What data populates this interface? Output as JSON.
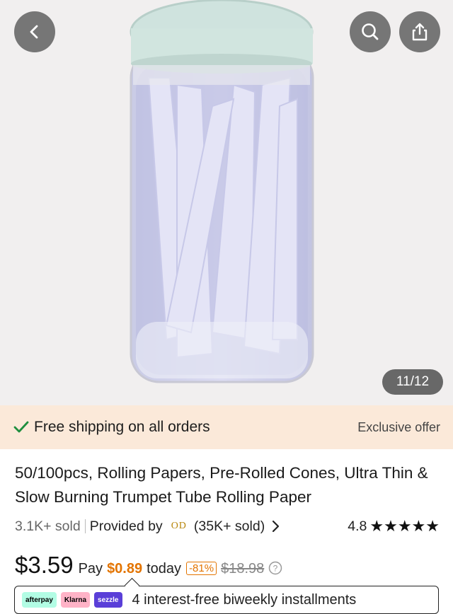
{
  "gallery": {
    "counter": "11/12"
  },
  "shipping": {
    "text": "Free shipping on all orders",
    "offer": "Exclusive offer"
  },
  "product": {
    "title": "50/100pcs, Rolling Papers, Pre-Rolled Cones, Ultra Thin & Slow Burning Trumpet Tube Rolling Paper",
    "sold": "3.1K+ sold",
    "provided_by": "Provided by",
    "provider_logo": "OD",
    "provider_sold": "(35K+ sold)",
    "rating": "4.8",
    "rating_stars": "★★★★★"
  },
  "pricing": {
    "price": "$3.59",
    "pay_label": "Pay",
    "pay_amount": "$0.89",
    "today": "today",
    "discount": "-81%",
    "original_price": "$18.98"
  },
  "installments": {
    "badges": [
      "afterpay",
      "Klarna",
      "sezzle"
    ],
    "text": "4 interest-free biweekly installments"
  },
  "colors": {
    "accent_orange": "#e37400",
    "ship_bar_bg": "#fbe9d9",
    "check_green": "#1e8e3e"
  }
}
